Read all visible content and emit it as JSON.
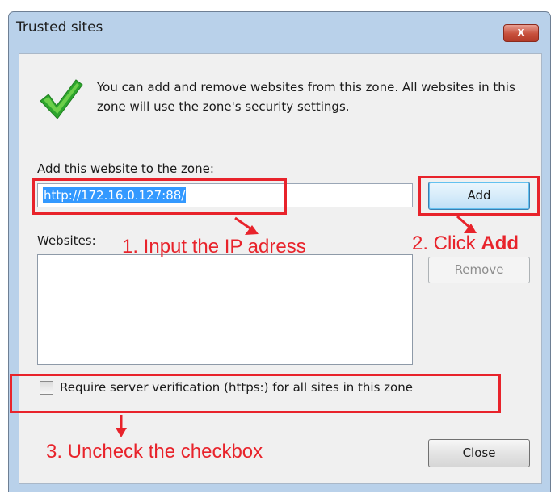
{
  "window": {
    "title": "Trusted sites",
    "close_glyph": "x",
    "info_icon": "green-checkmark",
    "info_text": "You can add and remove websites from this zone. All websites in this zone will use the zone's security settings."
  },
  "add_section": {
    "label": "Add this website to the zone:",
    "input_value": "http://172.16.0.127:88/",
    "add_button": "Add"
  },
  "websites": {
    "label": "Websites:",
    "items": [],
    "remove_button": "Remove"
  },
  "verification": {
    "checked": false,
    "label": "Require server verification (https:) for all sites in this zone"
  },
  "footer": {
    "close_button": "Close"
  },
  "annotations": {
    "step1": "1. Input the IP adress",
    "step2_prefix": "2. Click ",
    "step2_bold": "Add",
    "step3": "3. Uncheck the checkbox",
    "color": "#e8232b"
  }
}
